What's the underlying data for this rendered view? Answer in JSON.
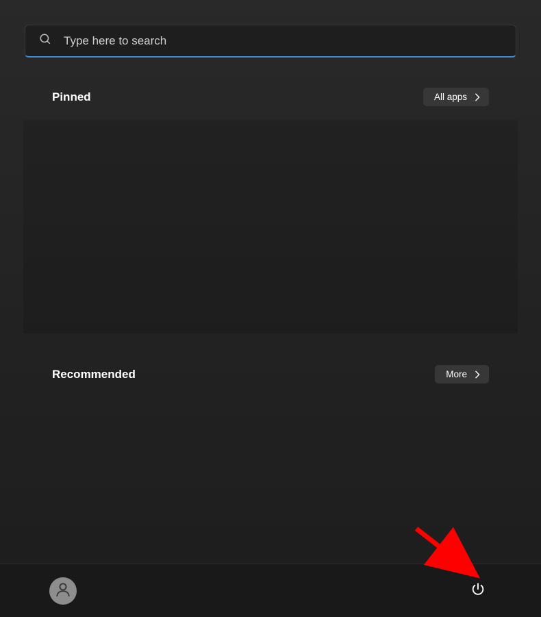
{
  "search": {
    "placeholder": "Type here to search",
    "value": ""
  },
  "sections": {
    "pinned": {
      "title": "Pinned",
      "button_label": "All apps"
    },
    "recommended": {
      "title": "Recommended",
      "button_label": "More"
    }
  },
  "footer": {
    "user_icon": "user-icon",
    "power_icon": "power-icon"
  },
  "annotation": {
    "arrow_target": "power-button",
    "color": "#ff0000"
  }
}
